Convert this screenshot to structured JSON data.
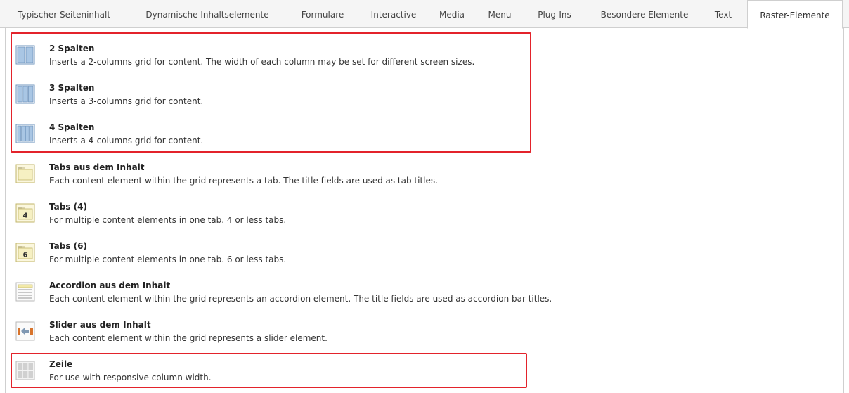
{
  "tabs": [
    {
      "label": "Typischer Seiteninhalt"
    },
    {
      "label": "Dynamische Inhaltselemente"
    },
    {
      "label": "Formulare"
    },
    {
      "label": "Interactive"
    },
    {
      "label": "Media"
    },
    {
      "label": "Menu"
    },
    {
      "label": "Plug-Ins"
    },
    {
      "label": "Besondere Elemente"
    },
    {
      "label": "Text"
    },
    {
      "label": "Raster-Elemente"
    }
  ],
  "active_tab": "Raster-Elemente",
  "elements": [
    {
      "title": "2 Spalten",
      "description": "Inserts a 2-columns grid for content. The width of each column may be set for different screen sizes.",
      "icon": "two-columns-icon"
    },
    {
      "title": "3 Spalten",
      "description": "Inserts a 3-columns grid for content.",
      "icon": "three-columns-icon"
    },
    {
      "title": "4 Spalten",
      "description": "Inserts a 4-columns grid for content.",
      "icon": "four-columns-icon"
    },
    {
      "title": "Tabs aus dem Inhalt",
      "description": "Each content element within the grid represents a tab. The title fields are used as tab titles.",
      "icon": "tab-folder-icon"
    },
    {
      "title": "Tabs (4)",
      "description": "For multiple content elements in one tab. 4 or less tabs.",
      "icon": "tabs-four-icon",
      "badge": "4"
    },
    {
      "title": "Tabs (6)",
      "description": "For multiple content elements in one tab. 6 or less tabs.",
      "icon": "tabs-six-icon",
      "badge": "6"
    },
    {
      "title": "Accordion aus dem Inhalt",
      "description": "Each content element within the grid represents an accordion element. The title fields are used as accordion bar titles.",
      "icon": "accordion-icon"
    },
    {
      "title": "Slider aus dem Inhalt",
      "description": "Each content element within the grid represents a slider element.",
      "icon": "slider-icon"
    },
    {
      "title": "Zeile",
      "description": "For use with responsive column width.",
      "icon": "row-grid-icon"
    }
  ],
  "colors": {
    "highlight_border": "#e3232b",
    "column_icon_fill": "#a9c6e4",
    "column_icon_border": "#6f94bd",
    "tab_icon_fill": "#f6f0c2",
    "tab_icon_border": "#c2b66a",
    "slider_accent": "#d8742c"
  }
}
